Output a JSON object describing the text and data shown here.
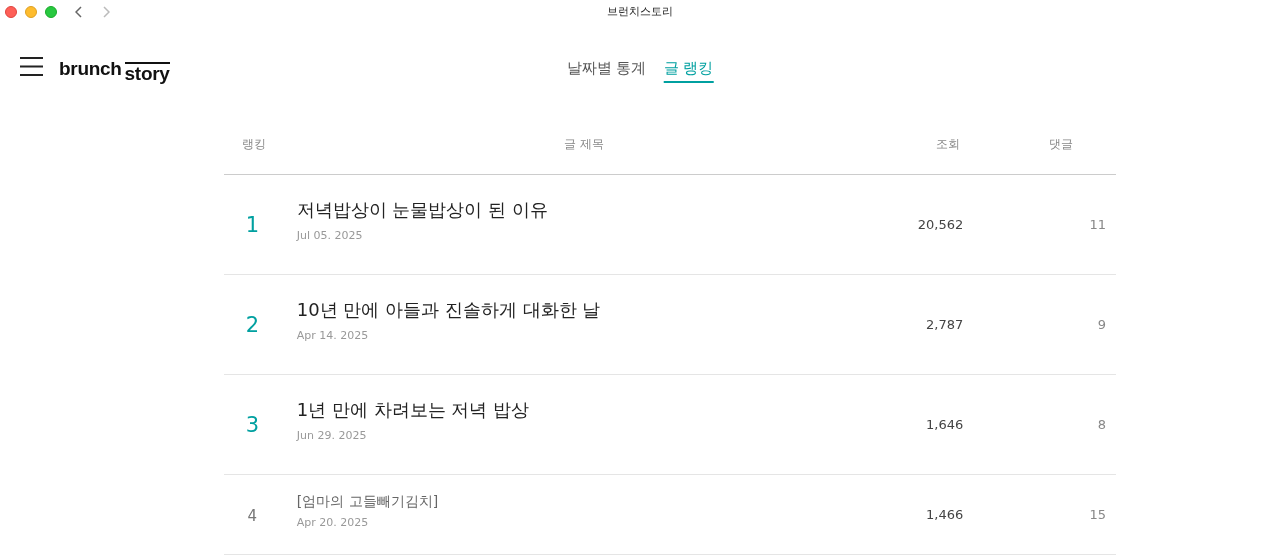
{
  "window": {
    "title": "브런치스토리"
  },
  "logo": {
    "part_1": "brunch",
    "part_2": "story"
  },
  "tabs": [
    {
      "label": "날짜별 통계",
      "selected": false
    },
    {
      "label": "글 랭킹",
      "selected": true
    }
  ],
  "table": {
    "columns": [
      "랭킹",
      "글 제목",
      "조회",
      "댓글"
    ],
    "rows": [
      {
        "kind": "top",
        "rank": "1",
        "title": "저녁밥상이 눈물밥상이 된 이유",
        "date": "Jul 05. 2025",
        "views": "20,562",
        "comments": "11"
      },
      {
        "kind": "top",
        "rank": "2",
        "title": "10년 만에 아들과 진솔하게 대화한 날",
        "date": "Apr 14. 2025",
        "views": "2,787",
        "comments": "9"
      },
      {
        "kind": "top",
        "rank": "3",
        "title": "1년 만에 차려보는 저녁 밥상",
        "date": "Jun 29. 2025",
        "views": "1,646",
        "comments": "8"
      },
      {
        "kind": "normal",
        "rank": "4",
        "title": "[엄마의 고들빼기김치]",
        "date": "Apr 20. 2025",
        "views": "1,466",
        "comments": "15"
      }
    ]
  }
}
